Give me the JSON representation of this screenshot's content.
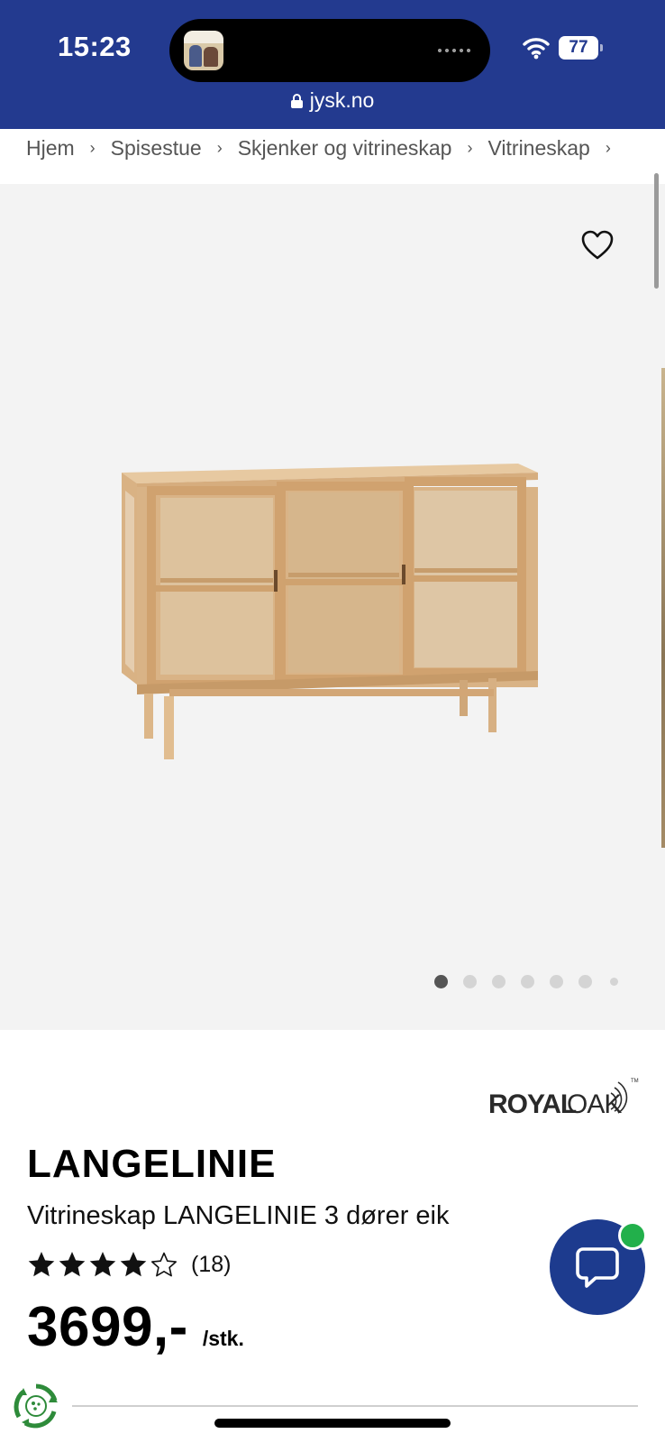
{
  "status_bar": {
    "time": "15:23",
    "battery": "77",
    "icons": [
      "wifi-icon",
      "battery-icon"
    ]
  },
  "browser": {
    "url": "jysk.no",
    "icons": [
      "lock-icon"
    ]
  },
  "breadcrumb": {
    "items": [
      "Hjem",
      "Spisestue",
      "Skjenker og vitrineskap",
      "Vitrineskap"
    ],
    "separator": "›"
  },
  "gallery": {
    "image_count": 7,
    "active_index": 0,
    "icons": [
      "heart-icon"
    ]
  },
  "product": {
    "brand": "ROYALOAK",
    "name": "LANGELINIE",
    "description": "Vitrineskap LANGELINIE 3 dører eik",
    "rating_stars": 4,
    "rating_max": 5,
    "review_count": "(18)",
    "price": "3699,-",
    "price_unit": "/stk."
  },
  "chat": {
    "online": true,
    "icons": [
      "chat-bubble-icon"
    ]
  },
  "colors": {
    "brand_blue": "#233a8f",
    "chat_blue": "#1d3b8e",
    "online_green": "#22b04b",
    "gallery_bg": "#f3f3f3"
  }
}
